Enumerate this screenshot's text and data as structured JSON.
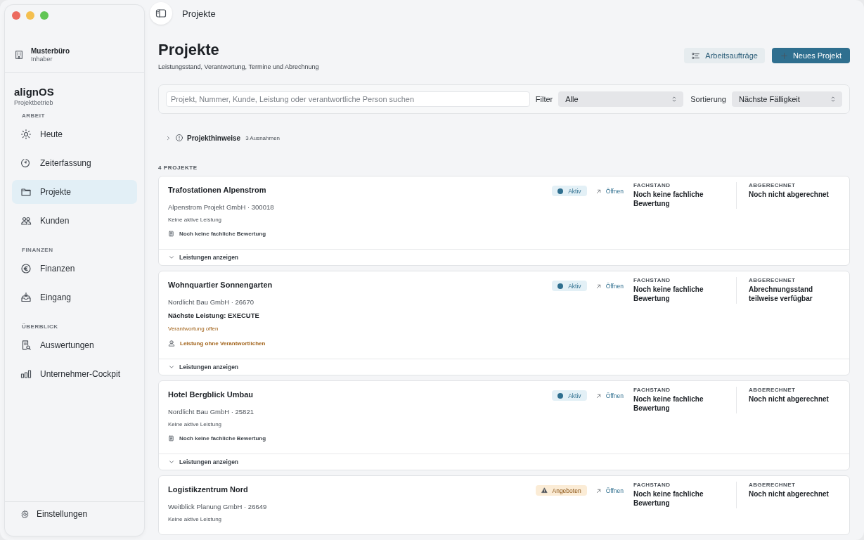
{
  "workspace": {
    "name": "Musterbüro",
    "role": "Inhaber"
  },
  "app": {
    "name": "alignOS",
    "subtitle": "Projektbetrieb"
  },
  "sidebar": {
    "sections": [
      {
        "heading": "ARBEIT",
        "items": [
          {
            "label": "Heute",
            "selected": false
          },
          {
            "label": "Zeiterfassung",
            "selected": false
          },
          {
            "label": "Projekte",
            "selected": true
          },
          {
            "label": "Kunden",
            "selected": false
          }
        ]
      },
      {
        "heading": "FINANZEN",
        "items": [
          {
            "label": "Finanzen",
            "selected": false
          },
          {
            "label": "Eingang",
            "selected": false
          }
        ]
      },
      {
        "heading": "ÜBERBLICK",
        "items": [
          {
            "label": "Auswertungen",
            "selected": false
          },
          {
            "label": "Unternehmer-Cockpit",
            "selected": false
          }
        ]
      }
    ],
    "footer_item": "Einstellungen"
  },
  "topbar": {
    "title": "Projekte"
  },
  "header": {
    "title": "Projekte",
    "subtitle": "Leistungsstand, Verantwortung, Termine und Abrechnung",
    "secondary_button": "Arbeitsaufträge",
    "primary_button": "Neues Projekt"
  },
  "toolbar": {
    "search": {
      "placeholder": "Projekt, Nummer, Kunde, Leistung oder verantwortliche Person suchen"
    },
    "filter_label": "Filter",
    "filter_value": "Alle",
    "sort_label": "Sortierung",
    "sort_value": "Nächste Fälligkeit"
  },
  "notices": {
    "title": "Projekthinweise",
    "count": "3 Ausnahmen",
    "expanded": false
  },
  "list_heading": "4 PROJEKTE",
  "projects": [
    {
      "title": "Trafostationen Alpenstrom",
      "client": "Alpenstrom Projekt GmbH · 300018",
      "lines": [
        {
          "kind": "muted",
          "text": "Keine aktive Leistung"
        },
        {
          "kind": "note",
          "text": "Noch keine fachliche Bewertung"
        }
      ],
      "status": {
        "kind": "active",
        "label": "Aktiv"
      },
      "open": "Öffnen",
      "fachstand_label": "FACHSTAND",
      "fachstand": "Noch keine fachliche Bewertung",
      "billing_label": "ABGERECHNET",
      "billing": "Noch nicht abgerechnet",
      "footer": "Leistungen anzeigen"
    },
    {
      "title": "Wohnquartier Sonnengarten",
      "client": "Nordlicht Bau GmbH · 26670",
      "lines": [
        {
          "kind": "strong",
          "text": "Nächste Leistung: EXECUTE"
        },
        {
          "kind": "warning",
          "text": "Verantwortung offen"
        },
        {
          "kind": "alert",
          "text": "Leistung ohne Verantwortlichen"
        }
      ],
      "status": {
        "kind": "active",
        "label": "Aktiv"
      },
      "open": "Öffnen",
      "fachstand_label": "FACHSTAND",
      "fachstand": "Noch keine fachliche Bewertung",
      "billing_label": "ABGERECHNET",
      "billing": "Abrechnungsstand teilweise verfügbar",
      "footer": "Leistungen anzeigen"
    },
    {
      "title": "Hotel Bergblick Umbau",
      "client": "Nordlicht Bau GmbH · 25821",
      "lines": [
        {
          "kind": "muted",
          "text": "Keine aktive Leistung"
        },
        {
          "kind": "note",
          "text": "Noch keine fachliche Bewertung"
        }
      ],
      "status": {
        "kind": "active",
        "label": "Aktiv"
      },
      "open": "Öffnen",
      "fachstand_label": "FACHSTAND",
      "fachstand": "Noch keine fachliche Bewertung",
      "billing_label": "ABGERECHNET",
      "billing": "Noch nicht abgerechnet",
      "footer": "Leistungen anzeigen"
    },
    {
      "title": "Logistikzentrum Nord",
      "client": "Weitblick Planung GmbH · 26649",
      "lines": [
        {
          "kind": "muted",
          "text": "Keine aktive Leistung"
        }
      ],
      "status": {
        "kind": "offered",
        "label": "Angeboten"
      },
      "open": "Öffnen",
      "fachstand_label": "FACHSTAND",
      "fachstand": "Noch keine fachliche Bewertung",
      "billing_label": "ABGERECHNET",
      "billing": "Noch nicht abgerechnet"
    }
  ]
}
